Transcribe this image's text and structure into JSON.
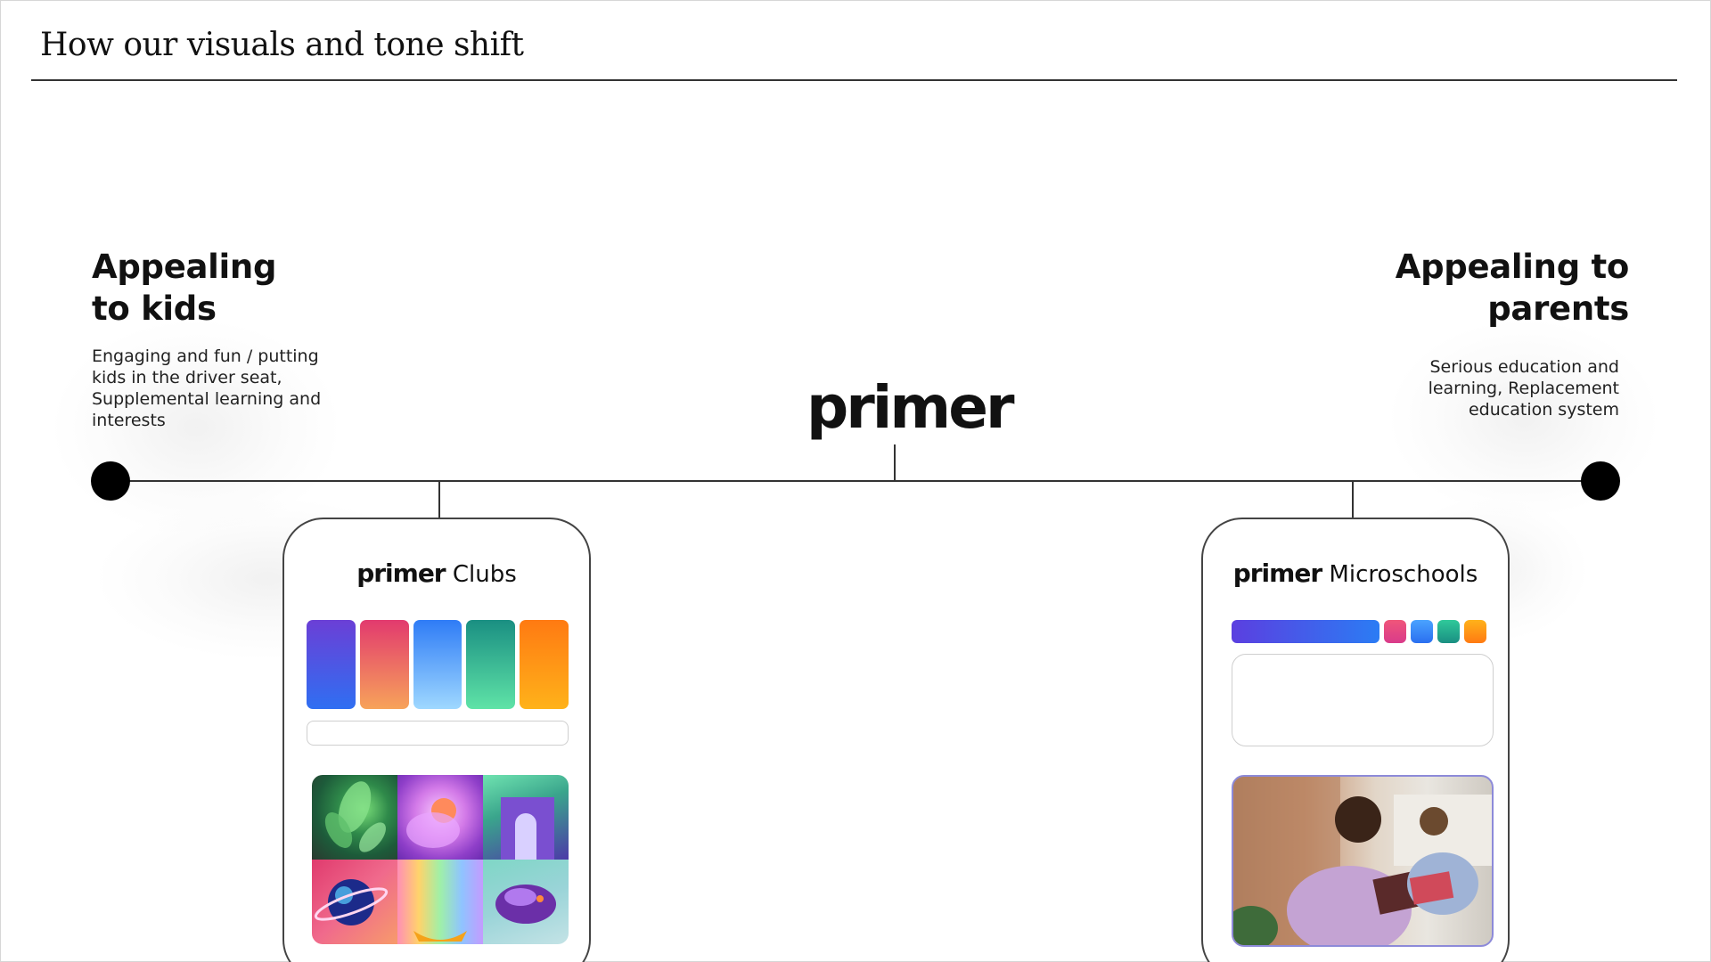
{
  "page": {
    "title": "How our visuals and tone shift"
  },
  "left": {
    "heading_line1": "Appealing",
    "heading_line2": "to kids",
    "description": "Engaging and fun / putting kids in the driver seat, Supplemental learning and interests"
  },
  "right": {
    "heading_line1": "Appealing to",
    "heading_line2": "parents",
    "description": "Serious education and learning, Replacement education system"
  },
  "center": {
    "brand": "primer"
  },
  "clubs_card": {
    "brand": "primer",
    "label": "Clubs",
    "swatches": [
      {
        "name": "violet-blue",
        "from": "#6b3fd6",
        "to": "#2f6ff2"
      },
      {
        "name": "pink-peach",
        "from": "#e23a6e",
        "to": "#f7a35a"
      },
      {
        "name": "sky-blue",
        "from": "#2f7cf6",
        "to": "#9fd8ff"
      },
      {
        "name": "teal-mint",
        "from": "#1a8f82",
        "to": "#5fe3a7"
      },
      {
        "name": "orange",
        "from": "#ff7a12",
        "to": "#ffb21a"
      }
    ]
  },
  "microschools_card": {
    "brand": "primer",
    "label": "Microschools",
    "swatches": [
      {
        "name": "indigo-bar",
        "from": "#5b3fe0",
        "to": "#2b7cf4"
      },
      {
        "name": "pink",
        "from": "#f0567a",
        "to": "#d93a8a"
      },
      {
        "name": "blue",
        "from": "#4aa3ff",
        "to": "#2a6ff0"
      },
      {
        "name": "teal",
        "from": "#2fc99a",
        "to": "#1a8f82"
      },
      {
        "name": "orange",
        "from": "#ffb21a",
        "to": "#ff7a12"
      }
    ]
  }
}
